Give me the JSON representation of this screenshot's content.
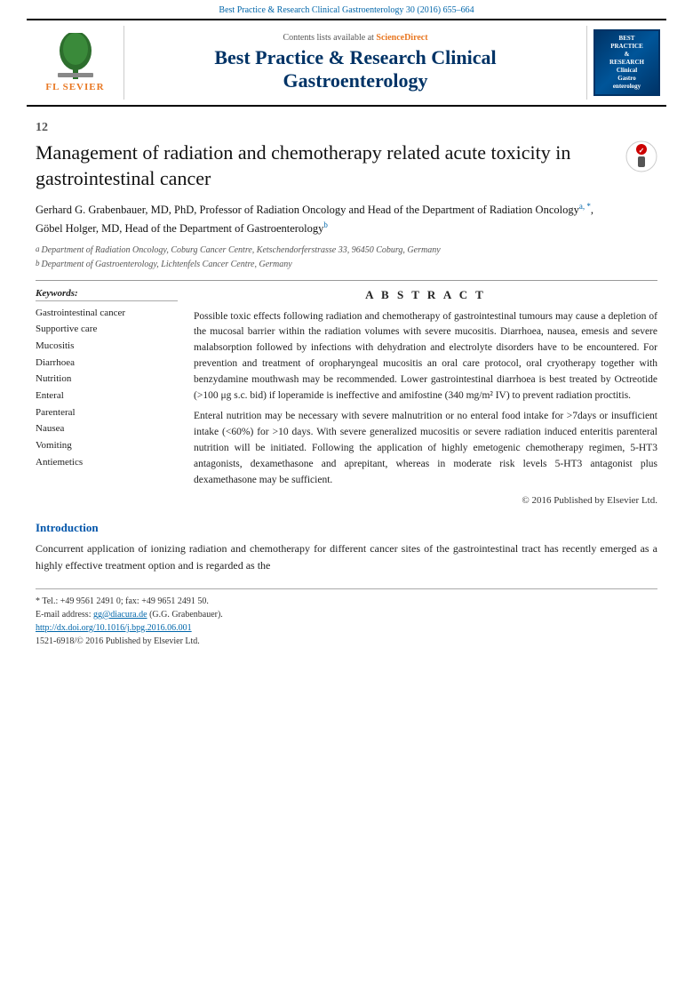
{
  "header": {
    "journal_bar": "Best Practice & Research Clinical Gastroenterology 30 (2016) 655–664",
    "science_direct_label": "Contents lists available at",
    "science_direct_link": "ScienceDirect",
    "journal_name_line1": "Best Practice & Research Clinical",
    "journal_name_line2": "Gastroenterology",
    "elsevier_text": "ELSEVIER",
    "elsevier_subtext": "FL SEVIER",
    "journal_logo_text": "BEST\nPRACTICE\n&\nRESEARCH\nClinical\nGastro\nenterology",
    "journal_logo_badge": "BEST"
  },
  "article": {
    "number": "12",
    "title": "Management of radiation and chemotherapy related acute toxicity in gastrointestinal cancer",
    "authors": "Gerhard G. Grabenbauer, MD, PhD, Professor of Radiation Oncology and Head of the Department of Radiation Oncology",
    "authors_sup1": "a, *",
    "author2": "Göbel Holger, MD, Head of the Department of Gastroenterology",
    "author2_sup": "b",
    "affiliations": [
      {
        "sup": "a",
        "text": "Department of Radiation Oncology, Coburg Cancer Centre, Ketschendorferstrasse 33, 96450 Coburg, Germany"
      },
      {
        "sup": "b",
        "text": "Department of Gastroenterology, Lichtenfels Cancer Centre, Germany"
      }
    ]
  },
  "keywords": {
    "title": "Keywords:",
    "items": [
      "Gastrointestinal cancer",
      "Supportive care",
      "Mucositis",
      "Diarrhoea",
      "Nutrition",
      "Enteral",
      "Parenteral",
      "Nausea",
      "Vomiting",
      "Antiemetics"
    ]
  },
  "abstract": {
    "title": "A B S T R A C T",
    "paragraph1": "Possible toxic effects following radiation and chemotherapy of gastrointestinal tumours may cause a depletion of the mucosal barrier within the radiation volumes with severe mucositis. Diarrhoea, nausea, emesis and severe malabsorption followed by infections with dehydration and electrolyte disorders have to be encountered. For prevention and treatment of oropharyngeal mucositis an oral care protocol, oral cryotherapy together with benzydamine mouthwash may be recommended. Lower gastrointestinal diarrhoea is best treated by Octreotide (>100 μg s.c. bid) if loperamide is ineffective and amifostine (340 mg/m² IV) to prevent radiation proctitis.",
    "paragraph2": "Enteral nutrition may be necessary with severe malnutrition or no enteral food intake for >7days or insufficient intake (<60%) for >10 days. With severe generalized mucositis or severe radiation induced enteritis parenteral nutrition will be initiated. Following the application of highly emetogenic chemotherapy regimen, 5-HT3 antagonists, dexamethasone and aprepitant, whereas in moderate risk levels 5-HT3 antagonist plus dexamethasone may be sufficient.",
    "copyright": "© 2016 Published by Elsevier Ltd."
  },
  "introduction": {
    "title": "Introduction",
    "text": "Concurrent application of ionizing radiation and chemotherapy for different cancer sites of the gastrointestinal tract has recently emerged as a highly effective treatment option and is regarded as the"
  },
  "footnotes": {
    "tel": "* Tel.: +49 9561 2491 0; fax: +49 9651 2491 50.",
    "email_label": "E-mail address:",
    "email": "gg@diacura.de",
    "email_suffix": " (G.G. Grabenbauer).",
    "doi_link": "http://dx.doi.org/10.1016/j.bpg.2016.06.001",
    "issn": "1521-6918/© 2016 Published by Elsevier Ltd."
  }
}
